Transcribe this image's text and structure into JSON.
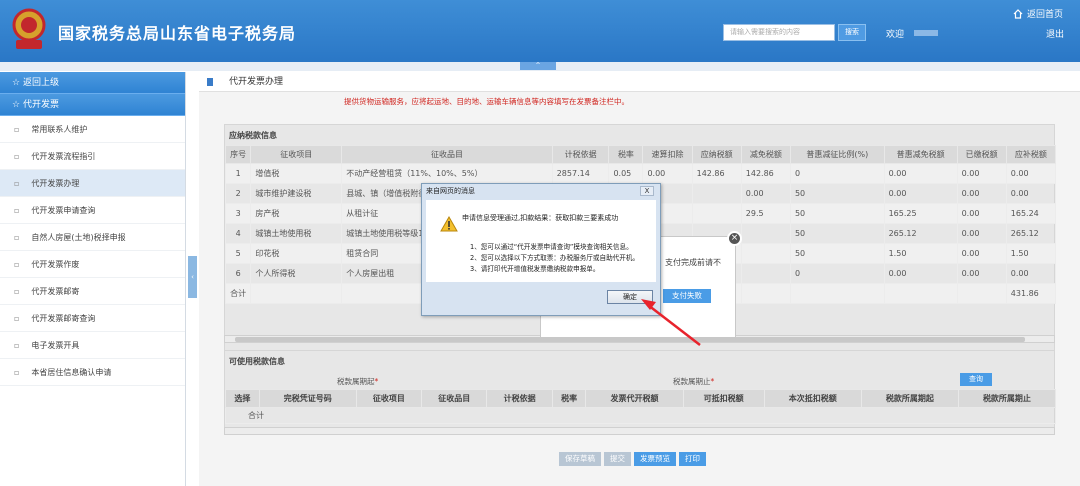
{
  "header": {
    "title": "国家税务总局山东省电子税务局",
    "search_placeholder": "请输入需要搜索的内容",
    "search_button": "搜索",
    "welcome": "欢迎",
    "home_link": "返回首页",
    "logout": "退出",
    "emblem_label": "山东税务"
  },
  "collapse_button": "^",
  "sidebar": {
    "back": "返回上级",
    "section": "代开发票",
    "items": [
      {
        "label": "常用联系人维护"
      },
      {
        "label": "代开发票流程指引"
      },
      {
        "label": "代开发票办理",
        "active": true
      },
      {
        "label": "代开发票申请查询"
      },
      {
        "label": "自然人房屋(土地)税择申报"
      },
      {
        "label": "代开发票作废"
      },
      {
        "label": "代开发票邮寄"
      },
      {
        "label": "代开发票邮寄查询"
      },
      {
        "label": "电子发票开具"
      },
      {
        "label": "本省居住信息确认申请"
      }
    ]
  },
  "breadcrumb": "代开发票办理",
  "notice": "提供货物运输服务，应将起运地、目的地、运输车辆信息等内容填写在发票备注栏中。",
  "tax_section": {
    "title": "应纳税款信息",
    "headers": [
      "序号",
      "征收项目",
      "征收品目",
      "计税依据",
      "税率",
      "速算扣除",
      "应纳税额",
      "减免税额",
      "普惠减征比例(%)",
      "普惠减免税额",
      "已缴税额",
      "应补税额"
    ],
    "rows": [
      [
        "1",
        "增值税",
        "不动产经营租赁（11%、10%、5%）",
        "2857.14",
        "0.05",
        "0.00",
        "142.86",
        "142.86",
        "0",
        "0.00",
        "0.00",
        "0.00"
      ],
      [
        "2",
        "城市维护建设税",
        "县城、镇（增值税附征）",
        "",
        "",
        "",
        "",
        "0.00",
        "50",
        "0.00",
        "0.00",
        "0.00"
      ],
      [
        "3",
        "房产税",
        "从租计征",
        "",
        "",
        "",
        "",
        "29.5",
        "50",
        "165.25",
        "0.00",
        "165.24"
      ],
      [
        "4",
        "城镇土地使用税",
        "城镇土地使用税等级1",
        "",
        "",
        "",
        "",
        "",
        "50",
        "265.12",
        "0.00",
        "265.12"
      ],
      [
        "5",
        "印花税",
        "租赁合同",
        "",
        "",
        "",
        "",
        "",
        "50",
        "1.50",
        "0.00",
        "1.50"
      ],
      [
        "6",
        "个人所得税",
        "个人房屋出租",
        "",
        "",
        "",
        "",
        "",
        "0",
        "0.00",
        "0.00",
        "0.00"
      ],
      [
        "合计",
        "",
        "",
        "",
        "",
        "",
        "",
        "",
        "",
        "",
        "",
        "431.86"
      ]
    ]
  },
  "avail_section": {
    "title": "可使用税款信息",
    "start_label": "税款属期起",
    "end_label": "税款属期止",
    "query_button": "查询",
    "headers": [
      "选择",
      "完税凭证号码",
      "征收项目",
      "征收品目",
      "计税依据",
      "税率",
      "发票代开税额",
      "可抵扣税额",
      "本次抵扣税额",
      "税款所属期起",
      "税款所属期止"
    ],
    "total": "合计"
  },
  "bottom_buttons": [
    "保存草稿",
    "提交",
    "发票预览",
    "打印"
  ],
  "popup_payment": {
    "text": "支付完成前请不",
    "failed_button": "支付失败"
  },
  "dialog": {
    "title": "来自网页的消息",
    "close": "X",
    "message": "申请信息受理通过,扣款结果：获取扣款三要素成功",
    "lines": [
      "1、您可以通过“代开发票申请查询”模块查询相关信息。",
      "2、您可以选择以下方式取票：办税服务厅或自助代开机。",
      "3、请打印代开增值税发票缴纳税款申报单。"
    ],
    "ok": "确定"
  },
  "colors": {
    "header": "#2a77c6",
    "accent": "#4a9ce6",
    "notice": "#d0251f",
    "arrow": "#e8232c"
  }
}
